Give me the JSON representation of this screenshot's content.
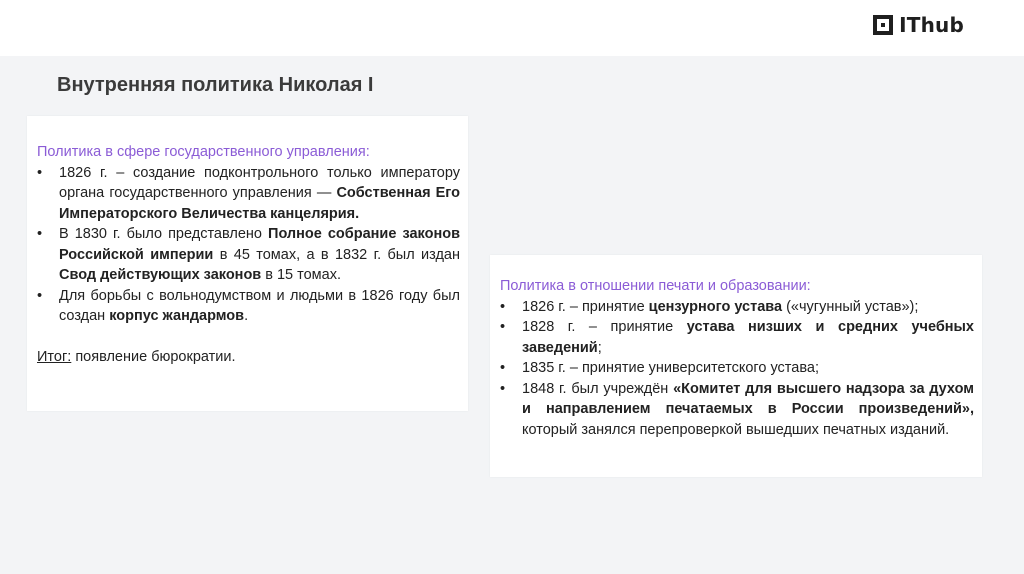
{
  "logo": {
    "text": "IThub"
  },
  "title": "Внутренняя политика Николая I",
  "left_card": {
    "heading": "Политика в сфере государственного управления:",
    "items": [
      {
        "t1": "1826 г. – создание подконтрольного только императору органа государственного управления — ",
        "b1": "Собственная Его Императорского Величества канцелярия."
      },
      {
        "t1": "В 1830 г. было представлено ",
        "b1": "Полное собрание законов Российской империи",
        "t2": " в 45 томах, а в 1832 г. был издан ",
        "b2": "Свод действующих законов",
        "t3": " в 15 томах."
      },
      {
        "t1": "Для борьбы с вольнодумством и людьми в 1826 году был создан ",
        "b1": "корпус жандармов",
        "t2": "."
      }
    ],
    "summary_label": "Итог:",
    "summary_text": " появление бюрократии."
  },
  "right_card": {
    "heading": "Политика в отношении печати и образовании:",
    "items": [
      {
        "t1": "1826 г. – принятие ",
        "b1": "цензурного устава",
        "t2": " («чугунный устав»);"
      },
      {
        "t1": "1828 г. – принятие ",
        "b1": "устава низших и средних учебных заведений",
        "t2": ";"
      },
      {
        "t1": "1835 г. – принятие университетского устава;"
      },
      {
        "t1": "1848 г. был учреждён ",
        "b1": "«Комитет для высшего надзора за духом и направлением печатаемых в России произведений»,",
        "t2": " который занялся перепроверкой вышедших печатных изданий."
      }
    ]
  }
}
